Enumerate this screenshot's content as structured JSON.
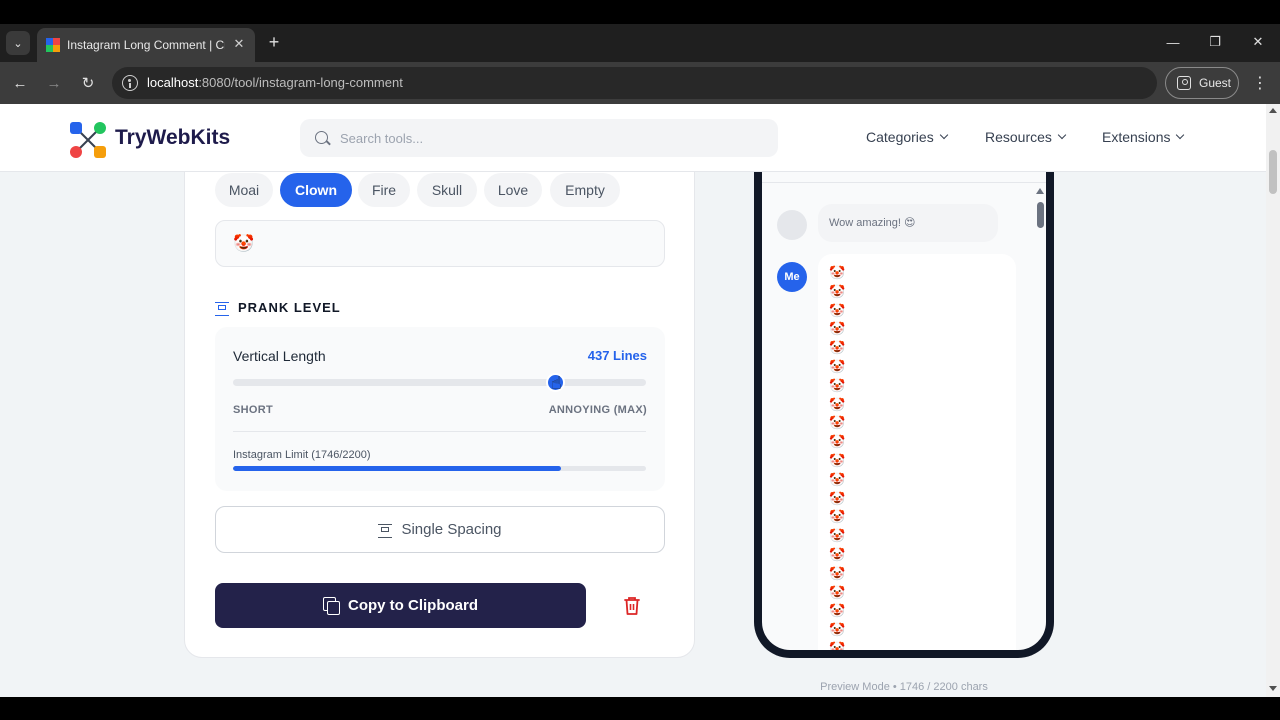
{
  "browser": {
    "tab_title": "Instagram Long Comment | Cre",
    "url_host": "localhost",
    "url_path": ":8080/tool/instagram-long-comment",
    "guest_label": "Guest"
  },
  "header": {
    "logo": "TryWebKits",
    "search_placeholder": "Search tools...",
    "nav": [
      "Categories",
      "Resources",
      "Extensions"
    ]
  },
  "tool": {
    "emoji_chips": [
      {
        "label": "Moai",
        "active": false
      },
      {
        "label": "Clown",
        "active": true
      },
      {
        "label": "Fire",
        "active": false
      },
      {
        "label": "Skull",
        "active": false
      },
      {
        "label": "Love",
        "active": false
      },
      {
        "label": "Empty",
        "active": false
      }
    ],
    "selected_emoji": "🤡",
    "prank_level_title": "PRANK LEVEL",
    "vertical_length_label": "Vertical Length",
    "vertical_length_value": "437 Lines",
    "slider_fraction": 0.78,
    "slider_min_label": "SHORT",
    "slider_max_label": "ANNOYING (MAX)",
    "limit_label": "Instagram Limit (1746/2200)",
    "limit_fraction": 0.7936,
    "spacing_button": "Single Spacing",
    "copy_button": "Copy to Clipboard"
  },
  "preview": {
    "other_comment": "Wow amazing! 😍",
    "me_avatar": "Me",
    "caption": "Preview Mode • 1746 / 2200 chars"
  },
  "colors": {
    "accent": "#2563eb",
    "dark_button": "#23224a",
    "delete": "#dc2626"
  }
}
